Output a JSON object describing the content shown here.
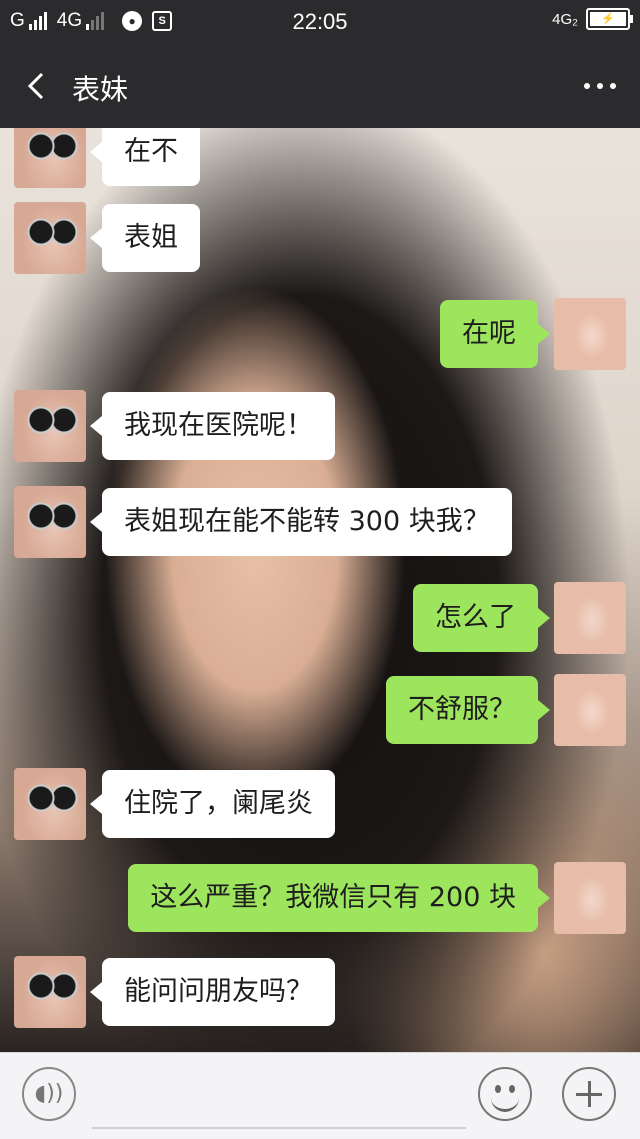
{
  "status_bar": {
    "carrier1": "G",
    "carrier2": "4G",
    "time": "22:05",
    "network_right": "4G₂",
    "icon_s": "S",
    "charging_icon": "⚡"
  },
  "header": {
    "title": "表妹",
    "back_icon": "chevron-left",
    "more_icon": "more-dots"
  },
  "messages": [
    {
      "sender": "them",
      "text": "在不"
    },
    {
      "sender": "them",
      "text": "表姐"
    },
    {
      "sender": "me",
      "text": "在呢"
    },
    {
      "sender": "them",
      "text": "我现在医院呢！"
    },
    {
      "sender": "them",
      "text": "表姐现在能不能转 300 块我？"
    },
    {
      "sender": "me",
      "text": "怎么了"
    },
    {
      "sender": "me",
      "text": "不舒服？"
    },
    {
      "sender": "them",
      "text": "住院了，阑尾炎"
    },
    {
      "sender": "me",
      "text": "这么严重？我微信只有 200 块"
    },
    {
      "sender": "them",
      "text": "能问问朋友吗？"
    }
  ],
  "input_bar": {
    "voice_icon": "voice-icon",
    "emoji_icon": "emoji-icon",
    "plus_icon": "plus-icon",
    "input_value": ""
  },
  "colors": {
    "bar_bg": "#2b2b2d",
    "my_bubble": "#9de55c",
    "their_bubble": "#ffffff"
  }
}
